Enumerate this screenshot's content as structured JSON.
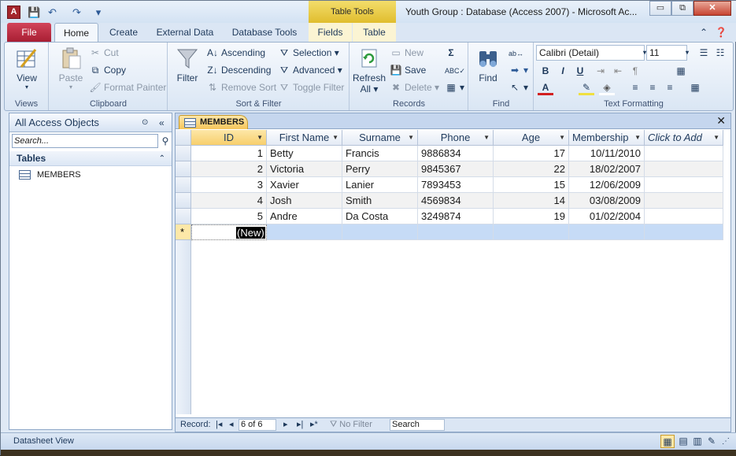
{
  "window": {
    "app_icon": "A",
    "title": "Youth Group : Database (Access 2007)  -  Microsoft Ac...",
    "context_tab_title": "Table Tools",
    "controls": {
      "minimize": "▭",
      "restore": "⧉",
      "close": "✕"
    }
  },
  "quick_access": {
    "save": "💾",
    "undo": "↶",
    "redo": "↷",
    "more": "▾"
  },
  "tabs": {
    "file": "File",
    "home": "Home",
    "create": "Create",
    "external": "External Data",
    "dbtools": "Database Tools",
    "fields": "Fields",
    "table": "Table"
  },
  "ribbon": {
    "views": {
      "label": "Views",
      "view_btn": "View"
    },
    "clipboard": {
      "label": "Clipboard",
      "paste": "Paste",
      "cut": "Cut",
      "copy": "Copy",
      "format_painter": "Format Painter"
    },
    "sort_filter": {
      "label": "Sort & Filter",
      "filter": "Filter",
      "ascending": "Ascending",
      "descending": "Descending",
      "remove_sort": "Remove Sort",
      "selection": "Selection",
      "advanced": "Advanced",
      "toggle_filter": "Toggle Filter"
    },
    "records": {
      "label": "Records",
      "refresh": "Refresh",
      "refresh_all": "All",
      "new": "New",
      "save": "Save",
      "delete": "Delete"
    },
    "find": {
      "label": "Find",
      "find": "Find"
    },
    "text_formatting": {
      "label": "Text Formatting",
      "font": "Calibri (Detail)",
      "size": "11",
      "bold": "B",
      "italic": "I",
      "underline": "U"
    }
  },
  "nav_pane": {
    "header": "All Access Objects",
    "search_placeholder": "Search...",
    "section": "Tables",
    "items": [
      "MEMBERS"
    ]
  },
  "document": {
    "tab": "MEMBERS",
    "columns": [
      "ID",
      "First Name",
      "Surname",
      "Phone",
      "Age",
      "Membership",
      "Click to Add"
    ],
    "rows": [
      {
        "id": "1",
        "first": "Betty",
        "surname": "Francis",
        "phone": "9886834",
        "age": "17",
        "membership": "10/11/2010"
      },
      {
        "id": "2",
        "first": "Victoria",
        "surname": "Perry",
        "phone": "9845367",
        "age": "22",
        "membership": "18/02/2007"
      },
      {
        "id": "3",
        "first": "Xavier",
        "surname": "Lanier",
        "phone": "7893453",
        "age": "15",
        "membership": "12/06/2009"
      },
      {
        "id": "4",
        "first": "Josh",
        "surname": "Smith",
        "phone": "4569834",
        "age": "14",
        "membership": "03/08/2009"
      },
      {
        "id": "5",
        "first": "Andre",
        "surname": "Da Costa",
        "phone": "3249874",
        "age": "19",
        "membership": "01/02/2004"
      }
    ],
    "new_row_marker": "*",
    "new_row_label": "(New)"
  },
  "record_nav": {
    "label": "Record:",
    "position": "6 of 6",
    "no_filter": "No Filter",
    "search": "Search"
  },
  "status": {
    "text": "Datasheet View"
  },
  "colors": {
    "accent": "#f6c55a",
    "file_tab": "#c0324a",
    "new_row": "#c6dbf6"
  }
}
